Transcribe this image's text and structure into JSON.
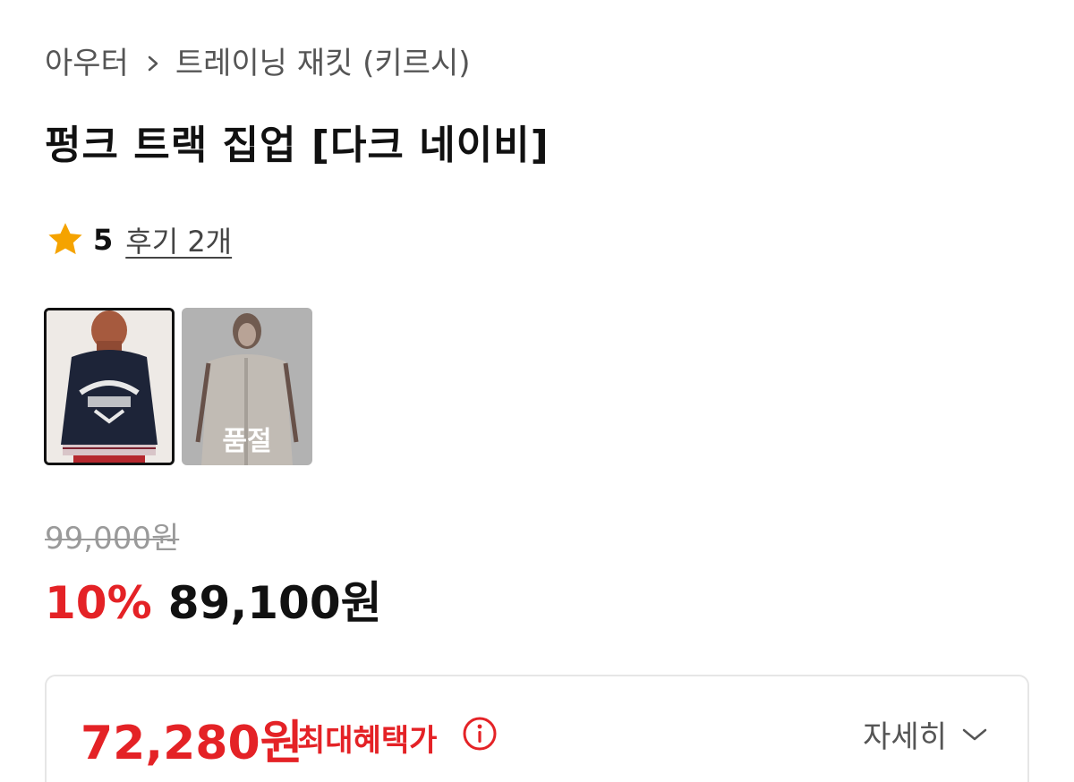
{
  "breadcrumb": {
    "category": "아우터",
    "subcategory": "트레이닝 재킷 (키르시)"
  },
  "product": {
    "title": "펑크 트랙 집업 [다크 네이비]",
    "rating": "5",
    "reviews_label": "후기 2개"
  },
  "thumbnails": [
    {
      "name": "navy-jacket-back",
      "selected": true,
      "sold_out": false
    },
    {
      "name": "beige-jacket-front",
      "selected": false,
      "sold_out": true,
      "overlay_label": "품절"
    }
  ],
  "pricing": {
    "original_price": "99,000원",
    "discount_rate": "10%",
    "sale_price": "89,100원"
  },
  "benefit": {
    "price": "72,280원",
    "label": "최대혜택가",
    "details_label": "자세히"
  },
  "colors": {
    "accent_red": "#e42226",
    "star": "#f5a300"
  },
  "icons": {
    "breadcrumb_separator": "chevron-right-icon",
    "rating": "star-icon",
    "info": "info-circle-icon",
    "expand": "chevron-down-icon"
  }
}
